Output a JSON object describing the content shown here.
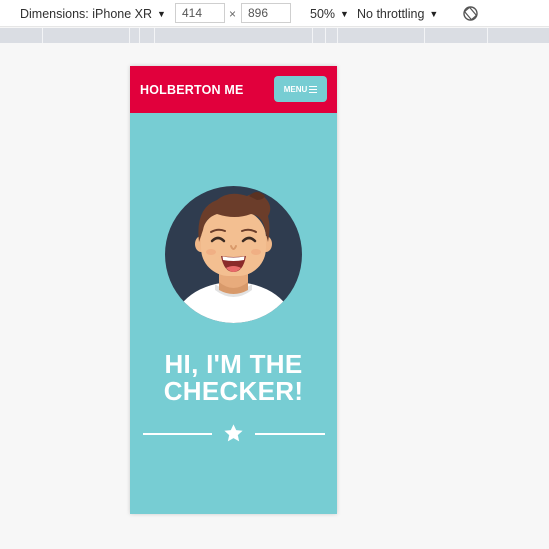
{
  "devtools": {
    "device_label": "Dimensions: iPhone XR",
    "width_value": "414",
    "height_value": "896",
    "times": "×",
    "zoom": "50%",
    "throttling": "No throttling",
    "caret": "▼",
    "rotate_icon": "rotate-icon"
  },
  "site": {
    "brand": "HOLBERTON ME",
    "menu_label": "MENU",
    "hero_line1": "HI, I'M THE",
    "hero_line2": "CHECKER!",
    "colors": {
      "header": "#e1003c",
      "accent": "#77cdd3",
      "avatar_bg": "#2f3c4f",
      "text": "#ffffff"
    }
  }
}
